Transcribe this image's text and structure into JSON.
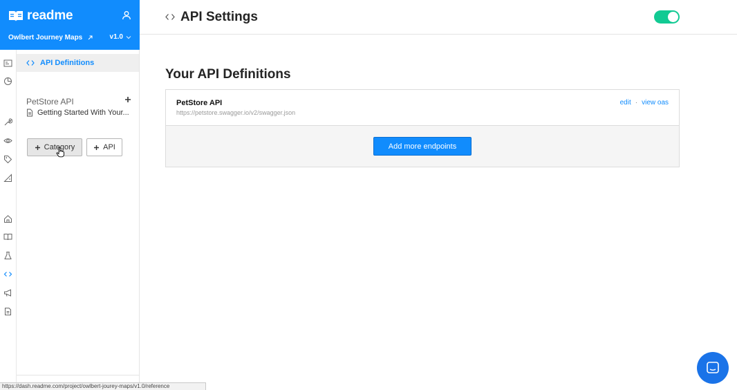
{
  "brand": {
    "name": "readme"
  },
  "project": {
    "name": "Owlbert Journey Maps",
    "version": "v1.0"
  },
  "nav": {
    "active_label": "API Definitions",
    "section_title": "PetStore API",
    "doc_item": "Getting Started With Your...",
    "category_button": "Category",
    "api_button": "API"
  },
  "rail_icons": [
    "dashboard-icon",
    "chart-icon",
    "wrench-icon",
    "eye-icon",
    "tag-icon",
    "pen-ruler-icon",
    "home-icon",
    "book-icon",
    "flask-icon",
    "code-icon",
    "megaphone-icon",
    "document-icon"
  ],
  "header": {
    "title": "API Settings",
    "toggle_on": true
  },
  "main": {
    "heading": "Your API Definitions",
    "api": {
      "name": "PetStore API",
      "url": "https://petstore.swagger.io/v2/swagger.json",
      "edit_label": "edit",
      "separator": "·",
      "view_label": "view oas"
    },
    "add_button": "Add more endpoints"
  },
  "status_bar": {
    "url": "https://dash.readme.com/project/owlbert-jourey-maps/v1.0/reference"
  },
  "colors": {
    "accent": "#118cfd",
    "toggle": "#12ca93",
    "chat": "#1a73e8"
  }
}
